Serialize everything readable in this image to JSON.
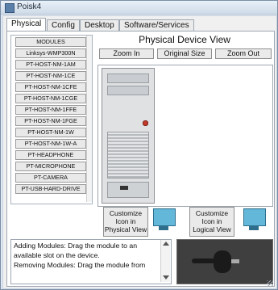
{
  "window": {
    "title": "Poisk4"
  },
  "tabs": [
    {
      "label": "Physical",
      "active": true
    },
    {
      "label": "Config",
      "active": false
    },
    {
      "label": "Desktop",
      "active": false
    },
    {
      "label": "Software/Services",
      "active": false
    }
  ],
  "modules": [
    "MODULES",
    "Linksys-WMP300N",
    "PT-HOST-NM-1AM",
    "PT-HOST-NM-1CE",
    "PT-HOST-NM-1CFE",
    "PT-HOST-NM-1CGE",
    "PT-HOST-NM-1FFE",
    "PT-HOST-NM-1FGE",
    "PT-HOST-NM-1W",
    "PT-HOST-NM-1W-A",
    "PT-HEADPHONE",
    "PT-MICROPHONE",
    "PT-CAMERA",
    "PT-USB-HARD-DRIVE"
  ],
  "view": {
    "title": "Physical Device View",
    "zoom_in": "Zoom In",
    "original_size": "Original Size",
    "zoom_out": "Zoom Out"
  },
  "customize": {
    "physical_line1": "Customize",
    "physical_line2": "Icon in",
    "physical_line3": "Physical View",
    "logical_line1": "Customize",
    "logical_line2": "Icon in",
    "logical_line3": "Logical View"
  },
  "info": {
    "line1": "Adding Modules: Drag the module to an",
    "line2": " available slot on the device.",
    "line3": "Removing Modules: Drag the module from"
  }
}
